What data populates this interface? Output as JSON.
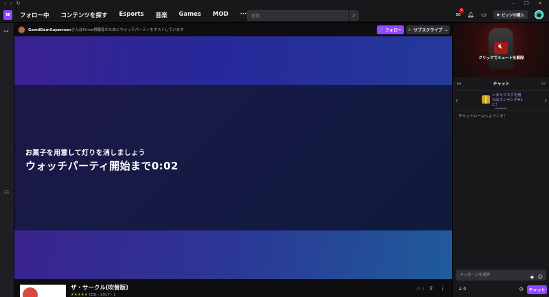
{
  "titlebar": {
    "back": "‹",
    "forward": "›",
    "reload": "↻",
    "minimize": "–",
    "restore": "❐",
    "close": "✕"
  },
  "nav": {
    "links": [
      "フォロー中",
      "コンテンツを探す",
      "Esports",
      "音楽",
      "Games",
      "MOD",
      "···"
    ],
    "search_placeholder": "検索",
    "notification_count": "6",
    "bits_label": "ビッツの購入"
  },
  "channel": {
    "streamer": "GawdDamSuperman",
    "hosting_text": "さんはPrime視聴者のためにウォッチパーティをホストしています",
    "follow_label": "フォロー",
    "subscribe_label": "サブスクライブ"
  },
  "video": {
    "subtitle": "お菓子を用意して灯りを消しましょう",
    "countdown": "ウォッチパーティ開始まで0:02"
  },
  "bottom": {
    "title": "ザ・サークル(吹替版)",
    "rating_stars": "★★★★★",
    "meta": "(33) · 2017 · 1",
    "viewer_count": "1"
  },
  "chat": {
    "preview_unmute": "クリックでミュートを解除",
    "header": "チャット",
    "promo_text": "いまサブスクを贈ればランキング#1に！",
    "welcome": "チャットルームへようこそ！",
    "input_placeholder": "メッセージを送信",
    "points": "0",
    "send_label": "チャット"
  },
  "colors": {
    "accent": "#9147ff",
    "background": "#0e0e10",
    "panel": "#18181b"
  }
}
